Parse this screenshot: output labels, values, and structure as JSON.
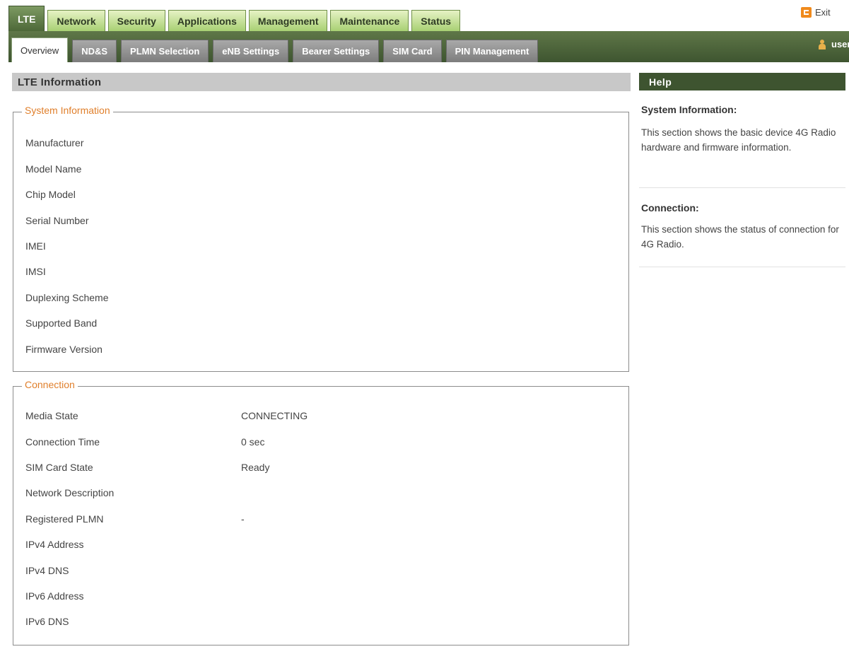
{
  "top_tabs": [
    "LTE",
    "Network",
    "Security",
    "Applications",
    "Management",
    "Maintenance",
    "Status"
  ],
  "sub_tabs": [
    "Overview",
    "ND&S",
    "PLMN Selection",
    "eNB Settings",
    "Bearer Settings",
    "SIM Card",
    "PIN Management"
  ],
  "header": {
    "exit_label": "Exit",
    "user_label": "user"
  },
  "section_title": "LTE Information",
  "system_info": {
    "legend": "System Information",
    "rows": [
      "Manufacturer",
      "Model Name",
      "Chip Model",
      "Serial Number",
      "IMEI",
      "IMSI",
      "Duplexing Scheme",
      "Supported Band",
      "Firmware Version"
    ]
  },
  "connection": {
    "legend": "Connection",
    "rows": [
      {
        "label": "Media State",
        "value": "CONNECTING"
      },
      {
        "label": "Connection Time",
        "value": "0 sec"
      },
      {
        "label": "SIM Card State",
        "value": "Ready"
      },
      {
        "label": "Network Description",
        "value": ""
      },
      {
        "label": "Registered PLMN",
        "value": "-"
      },
      {
        "label": "IPv4 Address",
        "value": ""
      },
      {
        "label": "IPv4 DNS",
        "value": ""
      },
      {
        "label": "IPv6 Address",
        "value": ""
      },
      {
        "label": "IPv6 DNS",
        "value": ""
      }
    ]
  },
  "help": {
    "title": "Help",
    "sections": [
      {
        "title": "System Information:",
        "text": "This section shows the basic device 4G Radio hardware and firmware information."
      },
      {
        "title": "Connection:",
        "text": "This section shows the status of connection for 4G Radio."
      }
    ]
  },
  "colors": {
    "accent_green": "#3e5430",
    "legend_orange": "#e07f2b",
    "exit_orange": "#f08a1c"
  },
  "icons": {
    "exit": "exit-icon",
    "user": "user-icon"
  }
}
